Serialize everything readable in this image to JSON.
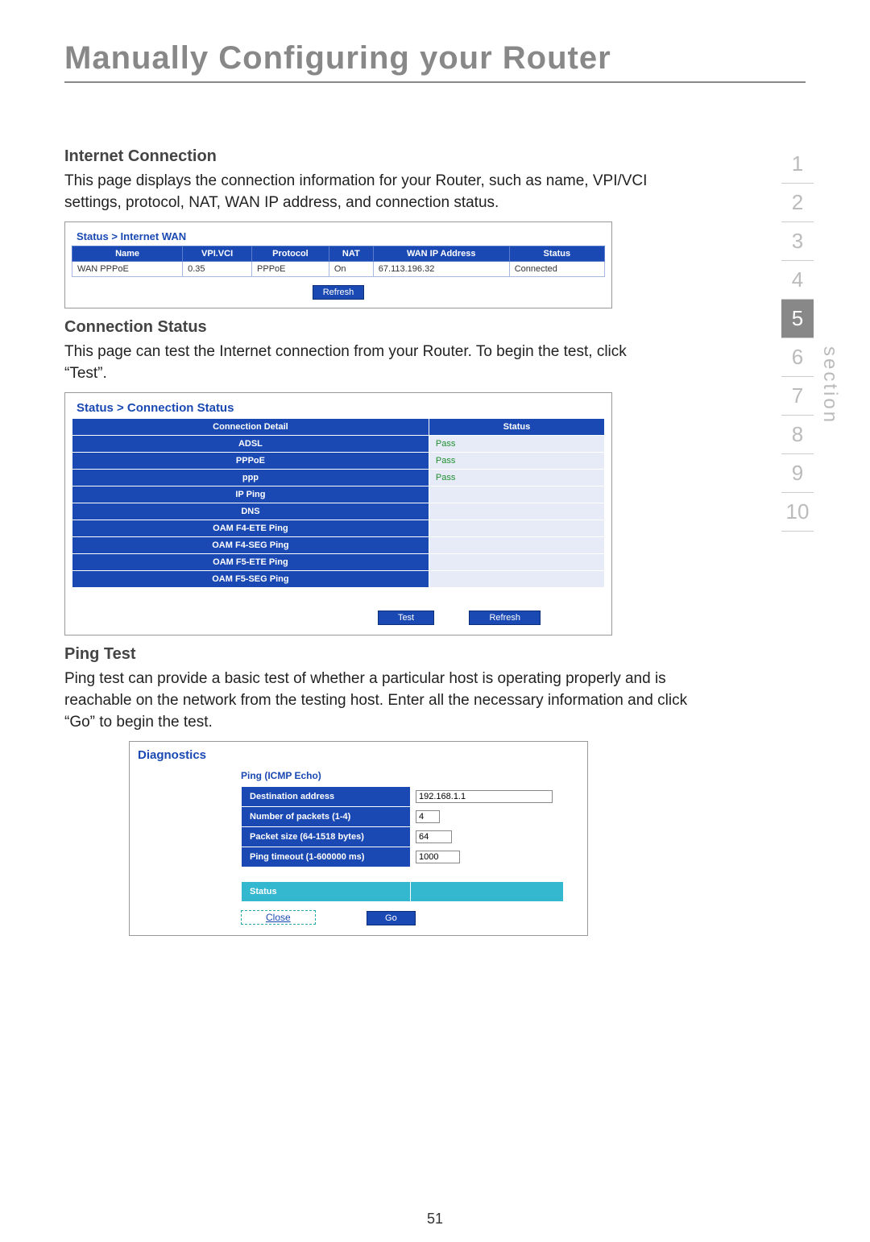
{
  "page_title": "Manually Configuring your Router",
  "page_number": "51",
  "section_label": "section",
  "section_nav": {
    "items": [
      "1",
      "2",
      "3",
      "4",
      "5",
      "6",
      "7",
      "8",
      "9",
      "10"
    ],
    "active_index": 4
  },
  "internet_connection": {
    "heading": "Internet Connection",
    "text": "This page displays the connection information for your Router, such as name, VPI/VCI settings, protocol, NAT, WAN IP address, and connection status.",
    "breadcrumb": "Status > Internet WAN",
    "columns": [
      "Name",
      "VPI.VCI",
      "Protocol",
      "NAT",
      "WAN IP Address",
      "Status"
    ],
    "row": {
      "name": "WAN PPPoE",
      "vpivci": "0.35",
      "protocol": "PPPoE",
      "nat": "On",
      "wan_ip": "67.113.196.32",
      "status": "Connected"
    },
    "refresh_label": "Refresh"
  },
  "connection_status": {
    "heading": "Connection Status",
    "text": "This page can test the Internet connection from your Router. To begin the test, click “Test”.",
    "breadcrumb": "Status > Connection Status",
    "columns": [
      "Connection Detail",
      "Status"
    ],
    "rows": [
      {
        "detail": "ADSL",
        "status": "Pass"
      },
      {
        "detail": "PPPoE",
        "status": "Pass"
      },
      {
        "detail": "ppp",
        "status": "Pass"
      },
      {
        "detail": "IP Ping",
        "status": ""
      },
      {
        "detail": "DNS",
        "status": ""
      },
      {
        "detail": "OAM F4-ETE Ping",
        "status": ""
      },
      {
        "detail": "OAM F4-SEG Ping",
        "status": ""
      },
      {
        "detail": "OAM F5-ETE Ping",
        "status": ""
      },
      {
        "detail": "OAM F5-SEG Ping",
        "status": ""
      }
    ],
    "test_label": "Test",
    "refresh_label": "Refresh"
  },
  "ping_test": {
    "heading": "Ping Test",
    "text": "Ping test can provide a basic test of whether a particular host is operating properly and is reachable on the network from the testing host. Enter all the necessary information and click “Go” to begin the test.",
    "diag_title": "Diagnostics",
    "subheading": "Ping (ICMP Echo)",
    "fields": {
      "destination_label": "Destination address",
      "destination_value": "192.168.1.1",
      "packets_label": "Number of packets (1-4)",
      "packets_value": "4",
      "size_label": "Packet size (64-1518 bytes)",
      "size_value": "64",
      "timeout_label": "Ping timeout (1-600000 ms)",
      "timeout_value": "1000"
    },
    "status_label": "Status",
    "status_value": "",
    "close_label": "Close",
    "go_label": "Go"
  }
}
